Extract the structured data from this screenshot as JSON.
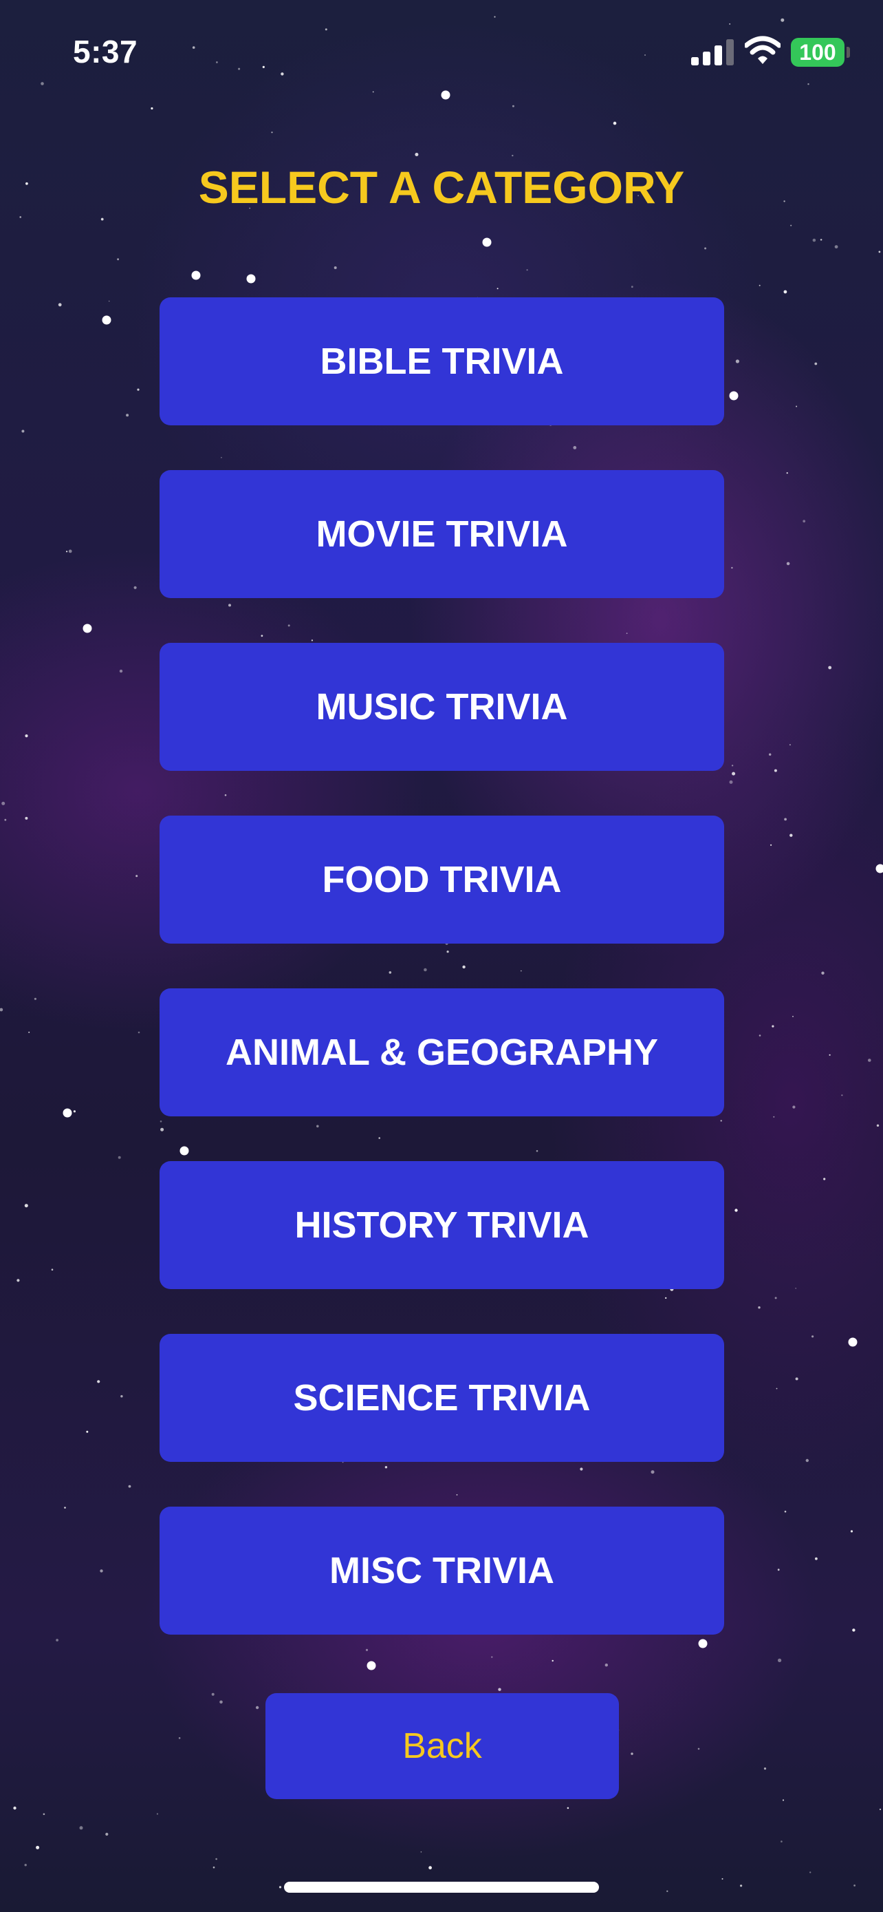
{
  "status_bar": {
    "time": "5:37",
    "battery": "100",
    "icons": [
      "signal-icon",
      "wifi-icon",
      "battery-icon"
    ],
    "battery_color": "#34c759"
  },
  "title": "SELECT A CATEGORY",
  "categories": [
    "BIBLE TRIVIA",
    "MOVIE TRIVIA",
    "MUSIC TRIVIA",
    "FOOD TRIVIA",
    "ANIMAL & GEOGRAPHY",
    "HISTORY TRIVIA",
    "SCIENCE TRIVIA",
    "MISC TRIVIA"
  ],
  "back_label": "Back",
  "colors": {
    "accent_yellow": "#f6c91e",
    "button_blue": "#3235d6",
    "background": "#1e1b3f"
  }
}
